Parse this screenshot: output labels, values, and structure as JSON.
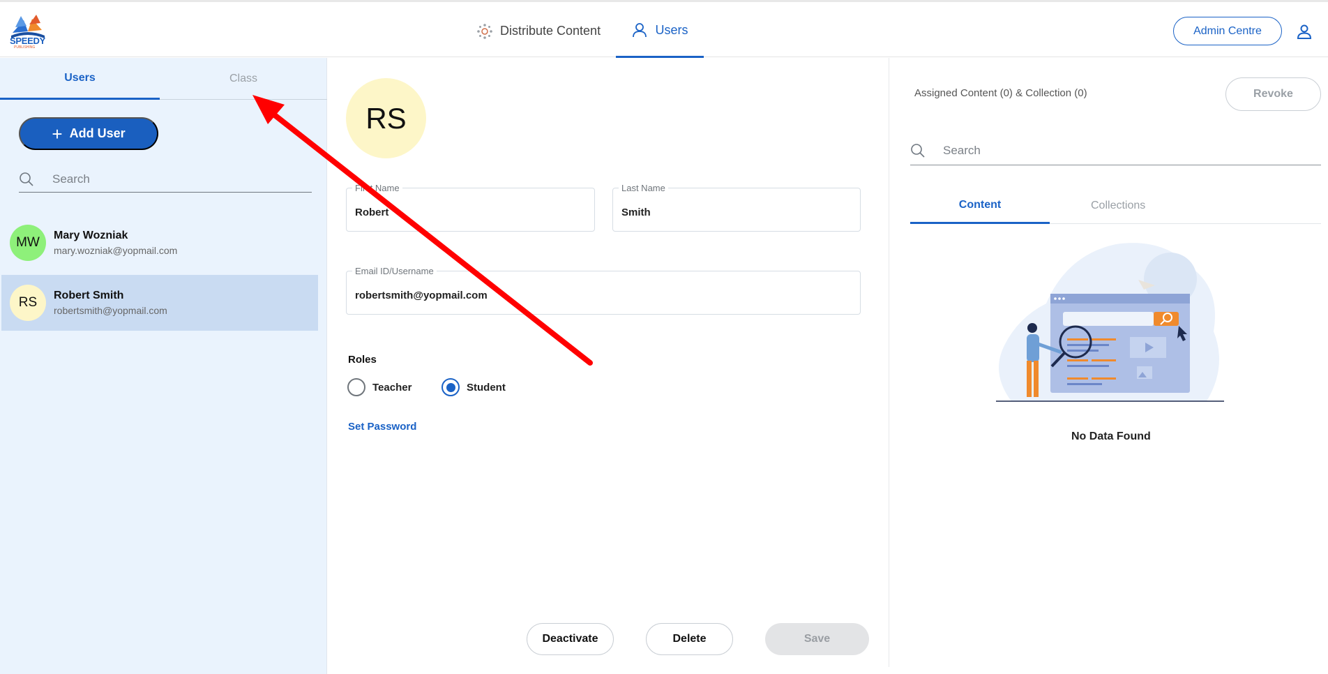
{
  "header": {
    "logo_text": "SPEEDY",
    "logo_subtext": "PUBLISHING",
    "nav": [
      {
        "label": "Distribute Content",
        "icon": "distribute-icon"
      },
      {
        "label": "Users",
        "icon": "user-icon",
        "active": true
      }
    ],
    "admin_label": "Admin Centre",
    "profile_icon": "account-icon"
  },
  "sidebar": {
    "tabs": [
      {
        "label": "Users",
        "active": true
      },
      {
        "label": "Class",
        "active": false
      }
    ],
    "add_user_label": "Add User",
    "search_placeholder": "Search",
    "users": [
      {
        "initials": "MW",
        "name": "Mary Wozniak",
        "email": "mary.wozniak@yopmail.com",
        "color": "#8ef07a",
        "selected": false
      },
      {
        "initials": "RS",
        "name": "Robert Smith",
        "email": "robertsmith@yopmail.com",
        "color": "#fdf6c8",
        "selected": true
      }
    ]
  },
  "detail": {
    "avatar_initials": "RS",
    "first_name_label": "First Name",
    "first_name_value": "Robert",
    "last_name_label": "Last Name",
    "last_name_value": "Smith",
    "email_label": "Email ID/Username",
    "email_value": "robertsmith@yopmail.com",
    "roles_label": "Roles",
    "roles": [
      {
        "label": "Teacher",
        "checked": false
      },
      {
        "label": "Student",
        "checked": true
      }
    ],
    "set_password_label": "Set Password",
    "deactivate_label": "Deactivate",
    "delete_label": "Delete",
    "save_label": "Save"
  },
  "assigned": {
    "title": "Assigned Content (0) & Collection (0)",
    "revoke_label": "Revoke",
    "search_placeholder": "Search",
    "tabs": [
      {
        "label": "Content",
        "active": true
      },
      {
        "label": "Collections",
        "active": false
      }
    ],
    "empty_label": "No Data Found"
  },
  "colors": {
    "accent": "#1a62c6",
    "sidebar_bg": "#eaf3fd",
    "selected_row": "#c9dbf2",
    "annotation_arrow": "#ff0000"
  }
}
